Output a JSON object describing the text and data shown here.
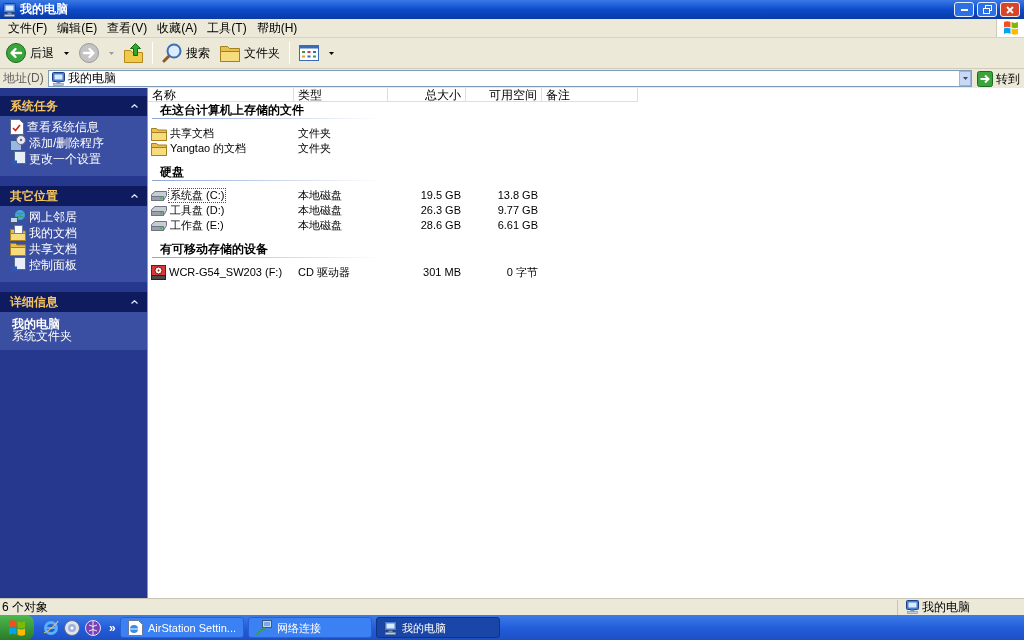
{
  "window": {
    "title": "我的电脑"
  },
  "window_controls": [
    {
      "kind": "minimize"
    },
    {
      "kind": "restore"
    },
    {
      "kind": "close"
    }
  ],
  "menu_bar": [
    "文件(F)",
    "编辑(E)",
    "查看(V)",
    "收藏(A)",
    "工具(T)",
    "帮助(H)"
  ],
  "toolbar": [
    [
      {
        "kind": "back",
        "label": "后退",
        "dropdown": true,
        "disabled": false
      },
      {
        "kind": "forward",
        "dropdown": true,
        "disabled": true
      },
      {
        "kind": "up",
        "dropdown": false,
        "disabled": false
      }
    ],
    [
      {
        "kind": "search",
        "label": "搜索",
        "dropdown": false,
        "disabled": false
      },
      {
        "kind": "folders",
        "label": "文件夹",
        "dropdown": false,
        "disabled": false
      }
    ],
    [
      {
        "kind": "views",
        "dropdown": true,
        "disabled": false
      }
    ]
  ],
  "address_bar": {
    "label": "地址(D)",
    "value": "我的电脑",
    "go_label": "转到"
  },
  "task_pane": [
    {
      "title": "系统任务",
      "expanded": true,
      "items": [
        {
          "kind": "system_info",
          "label": "查看系统信息"
        },
        {
          "kind": "programs",
          "label": "添加/删除程序"
        },
        {
          "kind": "settings",
          "label": "更改一个设置"
        }
      ]
    },
    {
      "title": "其它位置",
      "expanded": true,
      "items": [
        {
          "kind": "network",
          "label": "网上邻居"
        },
        {
          "kind": "documents",
          "label": "我的文档"
        },
        {
          "kind": "folder",
          "label": "共享文档"
        },
        {
          "kind": "settings",
          "label": "控制面板"
        }
      ]
    },
    {
      "title": "详细信息",
      "expanded": true,
      "details": {
        "name": "我的电脑",
        "description": "系统文件夹"
      }
    }
  ],
  "file_list": {
    "columns": [
      "名称",
      "类型",
      "总大小",
      "可用空间",
      "备注"
    ],
    "groups": [
      {
        "title": "在这台计算机上存储的文件",
        "items": [
          {
            "kind": "folder",
            "name": "共享文档",
            "type": "文件夹",
            "selected": false
          },
          {
            "kind": "folder",
            "name": "Yangtao 的文档",
            "type": "文件夹",
            "selected": false
          }
        ]
      },
      {
        "title": "硬盘",
        "items": [
          {
            "kind": "drive",
            "name": "系统盘 (C:)",
            "type": "本地磁盘",
            "total": "19.5 GB",
            "free": "13.8 GB",
            "selected": true
          },
          {
            "kind": "drive",
            "name": "工具盘 (D:)",
            "type": "本地磁盘",
            "total": "26.3 GB",
            "free": "9.77 GB",
            "selected": false
          },
          {
            "kind": "drive",
            "name": "工作盘 (E:)",
            "type": "本地磁盘",
            "total": "28.6 GB",
            "free": "6.61 GB",
            "selected": false
          }
        ]
      },
      {
        "title": "有可移动存储的设备",
        "items": [
          {
            "kind": "cd",
            "name": "WCR-G54_SW203 (F:)",
            "type": "CD 驱动器",
            "total": "301 MB",
            "free": "0 字节",
            "selected": false
          }
        ]
      }
    ]
  },
  "status_bar": {
    "text": "6 个对象",
    "zone": "我的电脑"
  },
  "taskbar": {
    "quick_launch": [
      {
        "kind": "browser"
      },
      {
        "kind": "disc"
      },
      {
        "kind": "globe"
      }
    ],
    "overflow": "»",
    "tasks": [
      {
        "kind": "web_page",
        "label": "AirStation Settin...",
        "selected": false
      },
      {
        "kind": "network",
        "label": "网络连接",
        "selected": false
      },
      {
        "kind": "computer",
        "label": "我的电脑",
        "selected": true
      }
    ]
  }
}
